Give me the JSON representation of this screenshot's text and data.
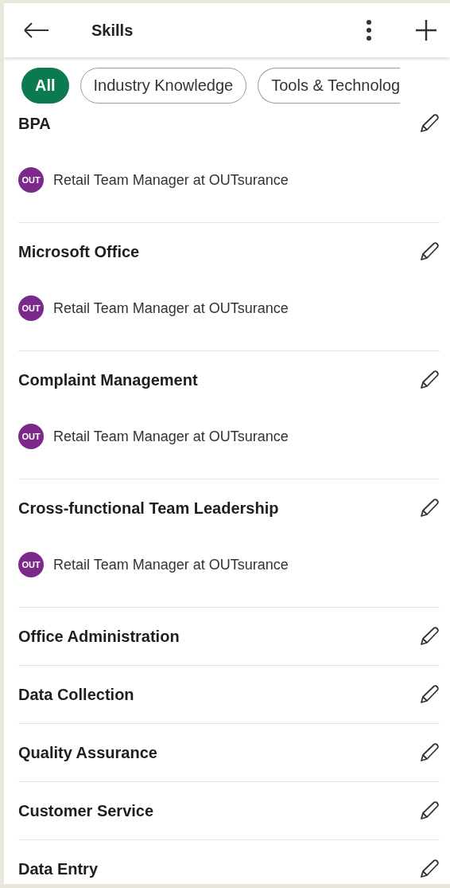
{
  "header": {
    "title": "Skills"
  },
  "filters": [
    {
      "label": "All",
      "selected": true
    },
    {
      "label": "Industry Knowledge",
      "selected": false
    },
    {
      "label": "Tools & Technolog",
      "selected": false
    }
  ],
  "skills": [
    {
      "name": "BPA",
      "position": {
        "logo_text": "OUT",
        "text": "Retail Team Manager at OUTsurance"
      }
    },
    {
      "name": "Microsoft Office",
      "position": {
        "logo_text": "OUT",
        "text": "Retail Team Manager at OUTsurance"
      }
    },
    {
      "name": "Complaint Management",
      "position": {
        "logo_text": "OUT",
        "text": "Retail Team Manager at OUTsurance"
      }
    },
    {
      "name": "Cross-functional Team Leadership",
      "position": {
        "logo_text": "OUT",
        "text": "Retail Team Manager at OUTsurance"
      }
    },
    {
      "name": "Office Administration"
    },
    {
      "name": "Data Collection"
    },
    {
      "name": "Quality Assurance"
    },
    {
      "name": "Customer Service"
    },
    {
      "name": "Data Entry"
    }
  ]
}
